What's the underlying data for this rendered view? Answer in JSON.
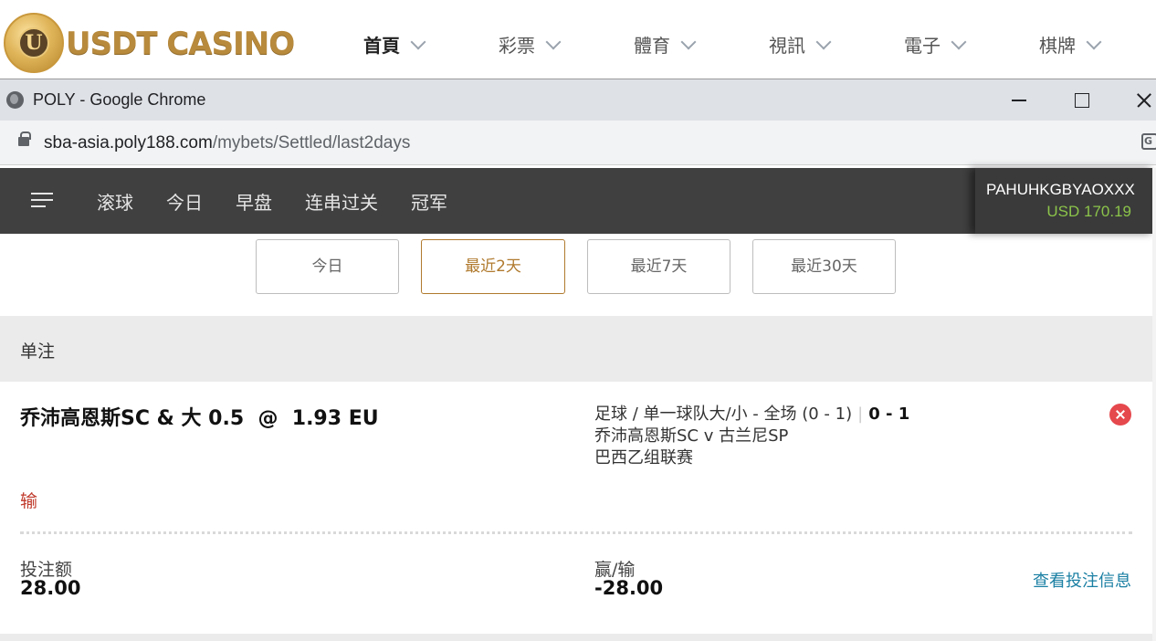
{
  "site": {
    "logo_letter": "U",
    "logo_text": "USDT CASINO",
    "nav": [
      {
        "label": "首頁",
        "active": true
      },
      {
        "label": "彩票"
      },
      {
        "label": "體育"
      },
      {
        "label": "視訊"
      },
      {
        "label": "電子"
      },
      {
        "label": "棋牌"
      }
    ]
  },
  "browser": {
    "title": "POLY - Google Chrome",
    "url_host": "sba-asia.poly188.com",
    "url_path": "/mybets/Settled/last2days",
    "translate_glyph": "G"
  },
  "app": {
    "tabs": [
      "滚球",
      "今日",
      "早盘",
      "连串过关",
      "冠军"
    ],
    "account_name": "PAHUHKGBYAOXXX",
    "balance": "USD 170.19"
  },
  "filters": [
    {
      "label": "今日",
      "active": false
    },
    {
      "label": "最近2天",
      "active": true
    },
    {
      "label": "最近7天",
      "active": false
    },
    {
      "label": "最近30天",
      "active": false
    }
  ],
  "section": {
    "title": "单注"
  },
  "bet": {
    "selection": "乔沛高恩斯SC & 大 0.5  @  1.93 EU",
    "market": "足球 / 单一球队大/小 - 全场 (0 - 1)",
    "separator": "|",
    "score": "0 - 1",
    "match": "乔沛高恩斯SC v 古兰尼SP",
    "league": "巴西乙组联赛",
    "status": "输",
    "stake_label": "投注额",
    "stake_value": "28.00",
    "winloss_label": "赢/输",
    "winloss_value": "-28.00",
    "details_link": "查看投注信息"
  },
  "colors": {
    "accent": "#b07a2e",
    "nav_bg": "#404040",
    "balance": "#8bc34a",
    "lose": "#c0392b",
    "link": "#1a7fa3",
    "close": "#e5484d"
  }
}
